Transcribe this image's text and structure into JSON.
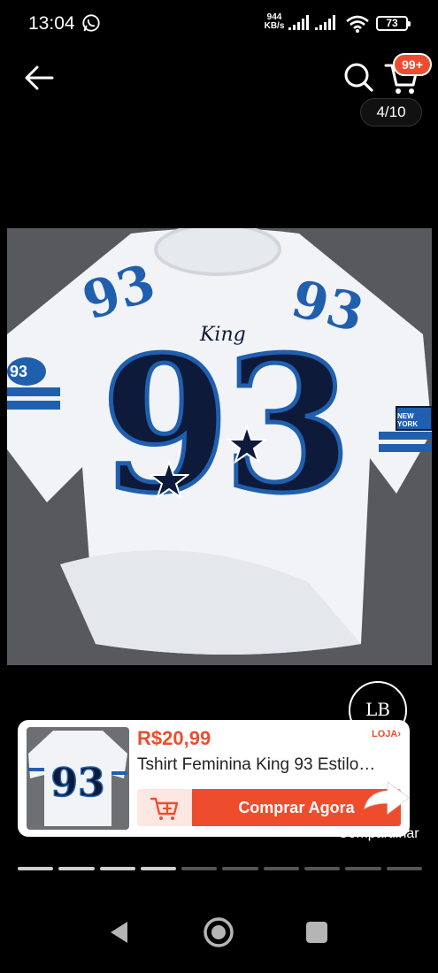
{
  "status_bar": {
    "time": "13:04",
    "net_speed_value": "944",
    "net_speed_unit": "KB/s",
    "battery": "73"
  },
  "header": {
    "cart_badge": "99+",
    "page_counter": "4/10",
    "icons": [
      "back-arrow-icon",
      "search-icon",
      "cart-icon"
    ]
  },
  "product_image": {
    "print_small": "King",
    "print_number": "93",
    "sleeve_number": "93",
    "patch": "NEW YORK"
  },
  "store": {
    "logo_text": "LB",
    "store_link": "LOJA",
    "share_label": "Compartilhar"
  },
  "product_card": {
    "price": "R$20,99",
    "title": "Tshirt Feminina King 93 Estilo…",
    "buy_label": "Comprar Agora"
  },
  "progress": {
    "total": 10,
    "current": 4
  },
  "colors": {
    "accent": "#ee4d2d",
    "accent_light": "#fde7e2",
    "jersey_blue": "#1f5fae",
    "jersey_navy": "#0e1a3a"
  }
}
